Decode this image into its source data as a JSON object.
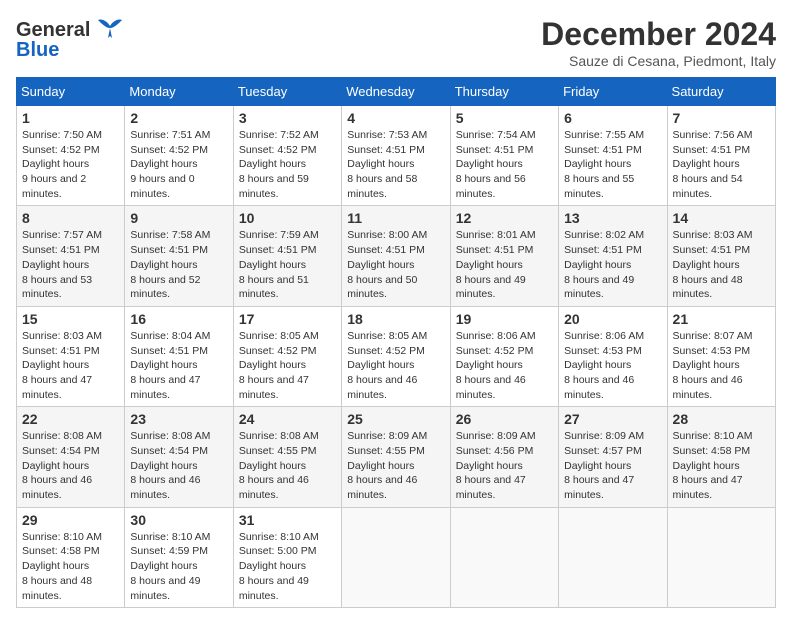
{
  "header": {
    "logo_general": "General",
    "logo_blue": "Blue",
    "title": "December 2024",
    "subtitle": "Sauze di Cesana, Piedmont, Italy"
  },
  "days_of_week": [
    "Sunday",
    "Monday",
    "Tuesday",
    "Wednesday",
    "Thursday",
    "Friday",
    "Saturday"
  ],
  "weeks": [
    [
      {
        "day": 1,
        "sunrise": "7:50 AM",
        "sunset": "4:52 PM",
        "daylight": "9 hours and 2 minutes."
      },
      {
        "day": 2,
        "sunrise": "7:51 AM",
        "sunset": "4:52 PM",
        "daylight": "9 hours and 0 minutes."
      },
      {
        "day": 3,
        "sunrise": "7:52 AM",
        "sunset": "4:52 PM",
        "daylight": "8 hours and 59 minutes."
      },
      {
        "day": 4,
        "sunrise": "7:53 AM",
        "sunset": "4:51 PM",
        "daylight": "8 hours and 58 minutes."
      },
      {
        "day": 5,
        "sunrise": "7:54 AM",
        "sunset": "4:51 PM",
        "daylight": "8 hours and 56 minutes."
      },
      {
        "day": 6,
        "sunrise": "7:55 AM",
        "sunset": "4:51 PM",
        "daylight": "8 hours and 55 minutes."
      },
      {
        "day": 7,
        "sunrise": "7:56 AM",
        "sunset": "4:51 PM",
        "daylight": "8 hours and 54 minutes."
      }
    ],
    [
      {
        "day": 8,
        "sunrise": "7:57 AM",
        "sunset": "4:51 PM",
        "daylight": "8 hours and 53 minutes."
      },
      {
        "day": 9,
        "sunrise": "7:58 AM",
        "sunset": "4:51 PM",
        "daylight": "8 hours and 52 minutes."
      },
      {
        "day": 10,
        "sunrise": "7:59 AM",
        "sunset": "4:51 PM",
        "daylight": "8 hours and 51 minutes."
      },
      {
        "day": 11,
        "sunrise": "8:00 AM",
        "sunset": "4:51 PM",
        "daylight": "8 hours and 50 minutes."
      },
      {
        "day": 12,
        "sunrise": "8:01 AM",
        "sunset": "4:51 PM",
        "daylight": "8 hours and 49 minutes."
      },
      {
        "day": 13,
        "sunrise": "8:02 AM",
        "sunset": "4:51 PM",
        "daylight": "8 hours and 49 minutes."
      },
      {
        "day": 14,
        "sunrise": "8:03 AM",
        "sunset": "4:51 PM",
        "daylight": "8 hours and 48 minutes."
      }
    ],
    [
      {
        "day": 15,
        "sunrise": "8:03 AM",
        "sunset": "4:51 PM",
        "daylight": "8 hours and 47 minutes."
      },
      {
        "day": 16,
        "sunrise": "8:04 AM",
        "sunset": "4:51 PM",
        "daylight": "8 hours and 47 minutes."
      },
      {
        "day": 17,
        "sunrise": "8:05 AM",
        "sunset": "4:52 PM",
        "daylight": "8 hours and 47 minutes."
      },
      {
        "day": 18,
        "sunrise": "8:05 AM",
        "sunset": "4:52 PM",
        "daylight": "8 hours and 46 minutes."
      },
      {
        "day": 19,
        "sunrise": "8:06 AM",
        "sunset": "4:52 PM",
        "daylight": "8 hours and 46 minutes."
      },
      {
        "day": 20,
        "sunrise": "8:06 AM",
        "sunset": "4:53 PM",
        "daylight": "8 hours and 46 minutes."
      },
      {
        "day": 21,
        "sunrise": "8:07 AM",
        "sunset": "4:53 PM",
        "daylight": "8 hours and 46 minutes."
      }
    ],
    [
      {
        "day": 22,
        "sunrise": "8:08 AM",
        "sunset": "4:54 PM",
        "daylight": "8 hours and 46 minutes."
      },
      {
        "day": 23,
        "sunrise": "8:08 AM",
        "sunset": "4:54 PM",
        "daylight": "8 hours and 46 minutes."
      },
      {
        "day": 24,
        "sunrise": "8:08 AM",
        "sunset": "4:55 PM",
        "daylight": "8 hours and 46 minutes."
      },
      {
        "day": 25,
        "sunrise": "8:09 AM",
        "sunset": "4:55 PM",
        "daylight": "8 hours and 46 minutes."
      },
      {
        "day": 26,
        "sunrise": "8:09 AM",
        "sunset": "4:56 PM",
        "daylight": "8 hours and 47 minutes."
      },
      {
        "day": 27,
        "sunrise": "8:09 AM",
        "sunset": "4:57 PM",
        "daylight": "8 hours and 47 minutes."
      },
      {
        "day": 28,
        "sunrise": "8:10 AM",
        "sunset": "4:58 PM",
        "daylight": "8 hours and 47 minutes."
      }
    ],
    [
      {
        "day": 29,
        "sunrise": "8:10 AM",
        "sunset": "4:58 PM",
        "daylight": "8 hours and 48 minutes."
      },
      {
        "day": 30,
        "sunrise": "8:10 AM",
        "sunset": "4:59 PM",
        "daylight": "8 hours and 49 minutes."
      },
      {
        "day": 31,
        "sunrise": "8:10 AM",
        "sunset": "5:00 PM",
        "daylight": "8 hours and 49 minutes."
      },
      null,
      null,
      null,
      null
    ]
  ],
  "labels": {
    "sunrise": "Sunrise:",
    "sunset": "Sunset:",
    "daylight": "Daylight hours"
  }
}
